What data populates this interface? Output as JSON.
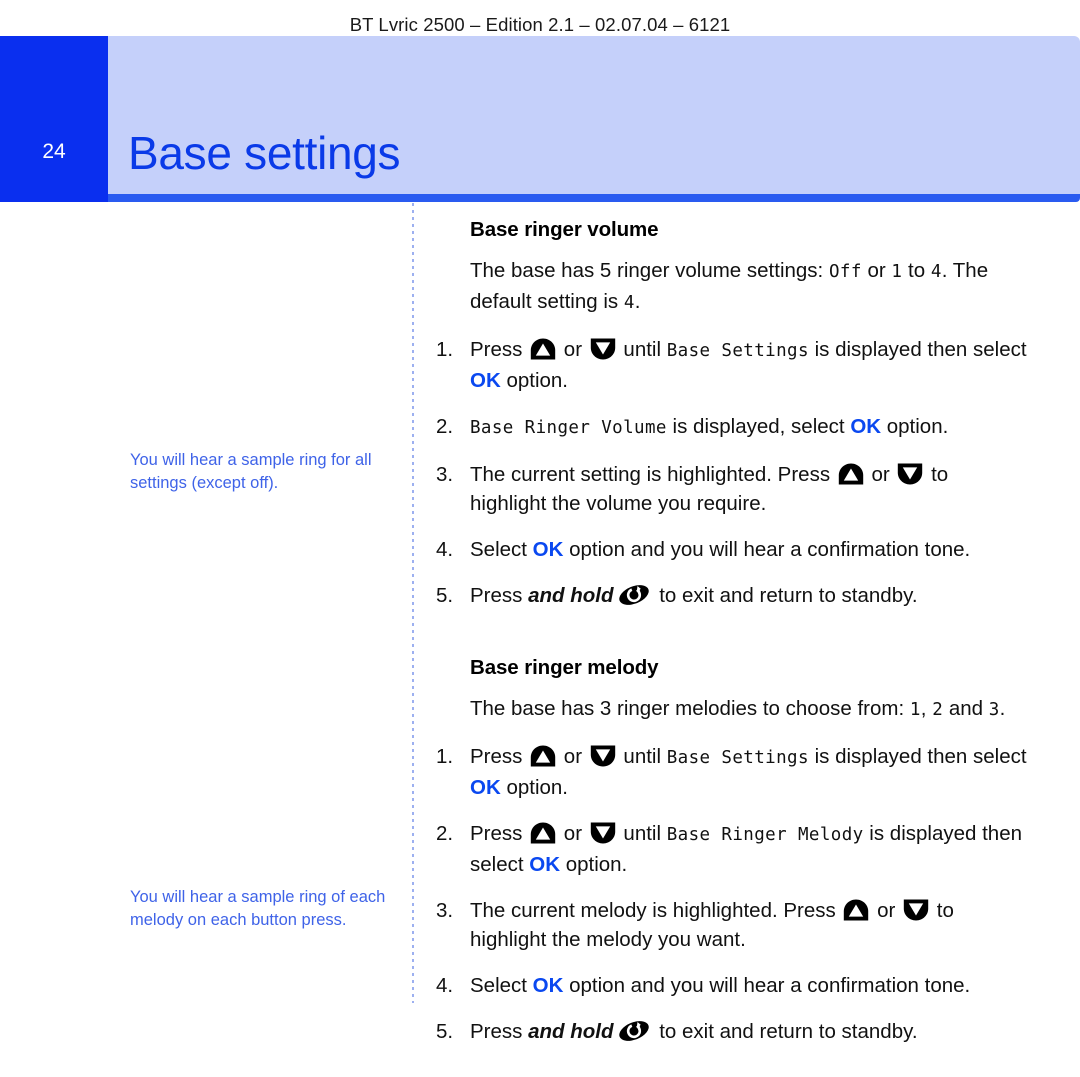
{
  "running_header": "BT Lvric 2500 – Edition 2.1 – 02.07.04 – 6121",
  "page_number": "24",
  "chapter_title": "Base settings",
  "colors": {
    "brand_blue": "#0a2fef",
    "band_blue": "#c5d0fa",
    "title_blue": "#0a3ae8",
    "note_blue": "#3f63e8",
    "ok_blue": "#0a48f0"
  },
  "side_notes": [
    "You will hear a sample ring for all settings (except off).",
    "You will hear a sample ring of each melody on each button press."
  ],
  "sections": [
    {
      "heading": "Base ringer volume",
      "intro_a": "The base has 5 ringer volume settings: ",
      "intro_lcd_1": "Off",
      "intro_b": " or ",
      "intro_lcd_2": "1",
      "intro_c": " to ",
      "intro_lcd_3": "4",
      "intro_d": ". The default setting is ",
      "intro_lcd_4": "4",
      "intro_e": ".",
      "steps": [
        {
          "num": "1.",
          "a": "Press ",
          "icon_up": "up-arrow-key-icon",
          "b": " or ",
          "icon_down": "down-arrow-key-icon",
          "c": " until ",
          "lcd": "Base Settings",
          "d": " is displayed then select ",
          "ok": "OK",
          "e": " option."
        },
        {
          "num": "2.",
          "lcd": "Base Ringer Volume",
          "d": " is displayed, select ",
          "ok": "OK",
          "e": " option."
        },
        {
          "num": "3.",
          "a": "The current setting is highlighted. Press ",
          "icon_up": "up-arrow-key-icon",
          "b": " or ",
          "icon_down": "down-arrow-key-icon",
          "c": " to highlight the volume you require."
        },
        {
          "num": "4.",
          "a": "Select ",
          "ok": "OK",
          "e": " option and you will hear a confirmation tone."
        },
        {
          "num": "5.",
          "a": "Press ",
          "bold_italic": "and hold",
          "icon_end": "end-call-key-icon",
          "e": " to exit and return to standby."
        }
      ]
    },
    {
      "heading": "Base ringer melody",
      "intro_a": "The base has 3 ringer melodies to choose from: ",
      "intro_lcd_1": "1",
      "intro_b": ", ",
      "intro_lcd_2": "2",
      "intro_c": " and ",
      "intro_lcd_3": "3",
      "intro_d": ".",
      "steps": [
        {
          "num": "1.",
          "a": "Press ",
          "icon_up": "up-arrow-key-icon",
          "b": " or ",
          "icon_down": "down-arrow-key-icon",
          "c": " until ",
          "lcd": "Base  Settings",
          "d": " is displayed then select ",
          "ok": "OK",
          "e": " option."
        },
        {
          "num": "2.",
          "a": "Press ",
          "icon_up": "up-arrow-key-icon",
          "b": " or ",
          "icon_down": "down-arrow-key-icon",
          "c": " until ",
          "lcd": "Base Ringer Melody",
          "d": " is displayed then select ",
          "ok": "OK",
          "e": " option."
        },
        {
          "num": "3.",
          "a": "The current melody is highlighted. Press ",
          "icon_up": "up-arrow-key-icon",
          "b": " or ",
          "icon_down": "down-arrow-key-icon",
          "c": " to highlight the melody you want."
        },
        {
          "num": "4.",
          "a": "Select ",
          "ok": "OK",
          "e": " option and you will hear a confirmation tone."
        },
        {
          "num": "5.",
          "a": "Press ",
          "bold_italic": "and hold",
          "icon_end": "end-call-key-icon",
          "e": " to exit and return to standby."
        }
      ]
    }
  ]
}
